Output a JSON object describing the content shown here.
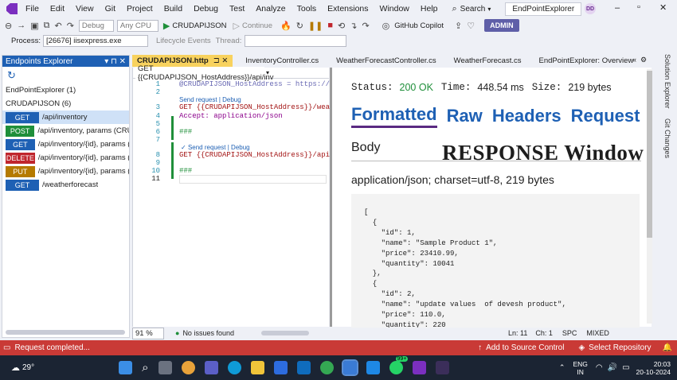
{
  "menu": [
    "File",
    "Edit",
    "View",
    "Git",
    "Project",
    "Build",
    "Debug",
    "Test",
    "Analyze",
    "Tools",
    "Extensions",
    "Window",
    "Help"
  ],
  "search_label": "Search",
  "project_title": "EndPointExplorer",
  "avatar_initials": "DD",
  "toolbar": {
    "config": "Debug",
    "platform": "Any CPU",
    "startup": "CRUDAPIJSON",
    "continue": "Continue",
    "copilot": "GitHub Copilot",
    "admin": "ADMIN",
    "process_label": "Process:",
    "process_value": "[26676] iisexpress.exe",
    "lifecycle": "Lifecycle Events",
    "thread_label": "Thread:"
  },
  "explorer": {
    "title": "Endpoints Explorer",
    "groups": [
      "EndPointExplorer (1)",
      "CRUDAPIJSON (6)"
    ],
    "endpoints": [
      {
        "method": "GET",
        "path": "/api/inventory",
        "color": "#1e60b4"
      },
      {
        "method": "POST",
        "path": "/api/inventory, params (CRUDA",
        "color": "#1f8f3a"
      },
      {
        "method": "GET",
        "path": "/api/inventory/{id}, params (int i",
        "color": "#1e60b4"
      },
      {
        "method": "DELETE",
        "path": "/api/inventory/{id}, params (int i",
        "color": "#c0262d"
      },
      {
        "method": "PUT",
        "path": "/api/inventory/{id}, params (int i",
        "color": "#b57a00"
      },
      {
        "method": "GET",
        "path": "/weatherforecast",
        "color": "#1e60b4"
      }
    ]
  },
  "tabs": [
    "CRUDAPIJSON.http",
    "InventoryController.cs",
    "WeatherForecastController.cs",
    "WeatherForecast.cs",
    "EndPointExplorer: Overview"
  ],
  "scope_value": "GET {{CRUDAPIJSON_HostAddress}}/api/inv",
  "code": {
    "l1": "@CRUDAPIJSON_HostAddress = https://locali",
    "send1": "Send request | Debug",
    "l3": "GET {{CRUDAPIJSON_HostAddress}}/weatherf",
    "l4": "Accept: application/json",
    "l6": "###",
    "send2": "Send request | Debug",
    "l8": "GET {{CRUDAPIJSON_HostAddress}}/api/inver",
    "l10": "###",
    "nums": [
      "1",
      "2",
      "3",
      "4",
      "5",
      "6",
      "7",
      "8",
      "9",
      "10",
      "11"
    ]
  },
  "response": {
    "status_label": "Status:",
    "status_value": "200 OK",
    "time_label": "Time:",
    "time_value": "448.54 ms",
    "size_label": "Size:",
    "size_value": "219 bytes",
    "tabs": [
      "Formatted",
      "Raw",
      "Headers",
      "Request"
    ],
    "body_label": "Body",
    "overlay": "RESPONSE Window",
    "content_type": "application/json; charset=utf-8, 219 bytes",
    "json_lines": [
      "[",
      "  {",
      "    \"id\": 1,",
      "    \"name\": \"Sample Product 1\",",
      "    \"price\": 23410.99,",
      "    \"quantity\": 10041",
      "  },",
      "  {",
      "    \"id\": 2,",
      "    \"name\": \"update values  of devesh product\",",
      "    \"price\": 110.0,",
      "    \"quantity\": 220"
    ]
  },
  "right_tabs": [
    "Solution Explorer",
    "Git Changes"
  ],
  "editor_status": {
    "zoom": "91 %",
    "issues": "No issues found",
    "ln": "Ln: 11",
    "ch": "Ch: 1",
    "spc": "SPC",
    "mixed": "MIXED"
  },
  "statusbar": {
    "message": "Request completed...",
    "add_source": "Add to Source Control",
    "select_repo": "Select Repository"
  },
  "taskbar": {
    "temp": "29°",
    "lang1": "ENG",
    "lang2": "IN",
    "time": "20:03",
    "date": "20-10-2024",
    "badge": "99+"
  }
}
